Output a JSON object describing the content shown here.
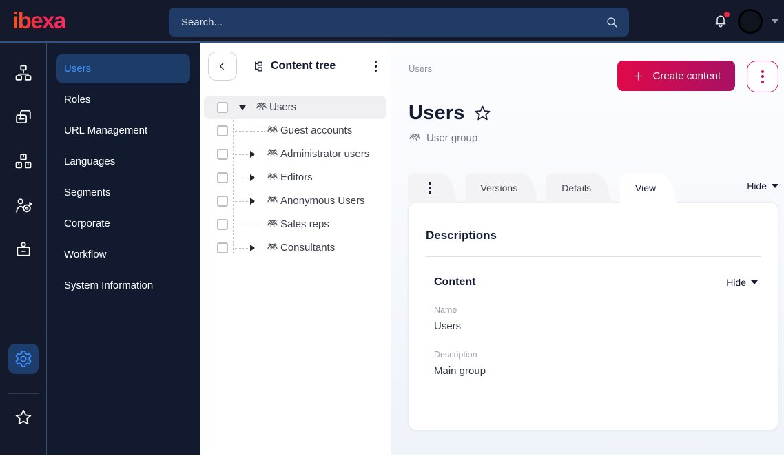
{
  "colors": {
    "topbar_bg": "#141a2c",
    "search_bg": "#203c66",
    "accent_blue": "#4191ff",
    "magenta": "#c11663",
    "button_gradient_start": "#e0094a",
    "button_gradient_end": "#a81164",
    "notification_badge": "#e8274b",
    "dark_text": "#131c33"
  },
  "topbar": {
    "logo_text": "ibexa",
    "search_placeholder": "Search..."
  },
  "icon_rail": {
    "top_items": [
      {
        "name": "content-structure",
        "icon": "sitemap-icon"
      },
      {
        "name": "page-builder",
        "icon": "pages-icon"
      },
      {
        "name": "product-catalog",
        "icon": "catalog-icon"
      },
      {
        "name": "personalization",
        "icon": "personalization-icon"
      },
      {
        "name": "admin-badge",
        "icon": "admin-badge-icon"
      }
    ],
    "bottom_items": [
      {
        "name": "settings",
        "icon": "gear-icon",
        "active": true
      },
      {
        "name": "bookmarks",
        "icon": "star-icon"
      }
    ]
  },
  "sidebar": {
    "items": [
      {
        "label": "Users",
        "active": true
      },
      {
        "label": "Roles"
      },
      {
        "label": "URL Management"
      },
      {
        "label": "Languages"
      },
      {
        "label": "Segments"
      },
      {
        "label": "Corporate"
      },
      {
        "label": "Workflow"
      },
      {
        "label": "System Information"
      }
    ]
  },
  "content_tree": {
    "title": "Content tree",
    "rows": [
      {
        "label": "Users",
        "level": 0,
        "expander": "expanded",
        "selected": true
      },
      {
        "label": "Guest accounts",
        "level": 1,
        "expander": "none"
      },
      {
        "label": "Administrator users",
        "level": 1,
        "expander": "collapsed"
      },
      {
        "label": "Editors",
        "level": 1,
        "expander": "collapsed"
      },
      {
        "label": "Anonymous Users",
        "level": 1,
        "expander": "collapsed"
      },
      {
        "label": "Sales reps",
        "level": 1,
        "expander": "none"
      },
      {
        "label": "Consultants",
        "level": 1,
        "expander": "collapsed"
      }
    ]
  },
  "main": {
    "breadcrumb": "Users",
    "create_content_label": "Create content",
    "page_title": "Users",
    "content_type_label": "User group",
    "tabs": [
      {
        "label": "View",
        "active": true
      },
      {
        "label": "Details"
      },
      {
        "label": "Versions"
      },
      {
        "type": "kebab"
      }
    ],
    "tabs_hide_label": "Hide",
    "card": {
      "heading": "Descriptions",
      "section_heading": "Content",
      "section_hide_label": "Hide",
      "fields": [
        {
          "label": "Name",
          "value": "Users"
        },
        {
          "label": "Description",
          "value": "Main group"
        }
      ]
    }
  }
}
